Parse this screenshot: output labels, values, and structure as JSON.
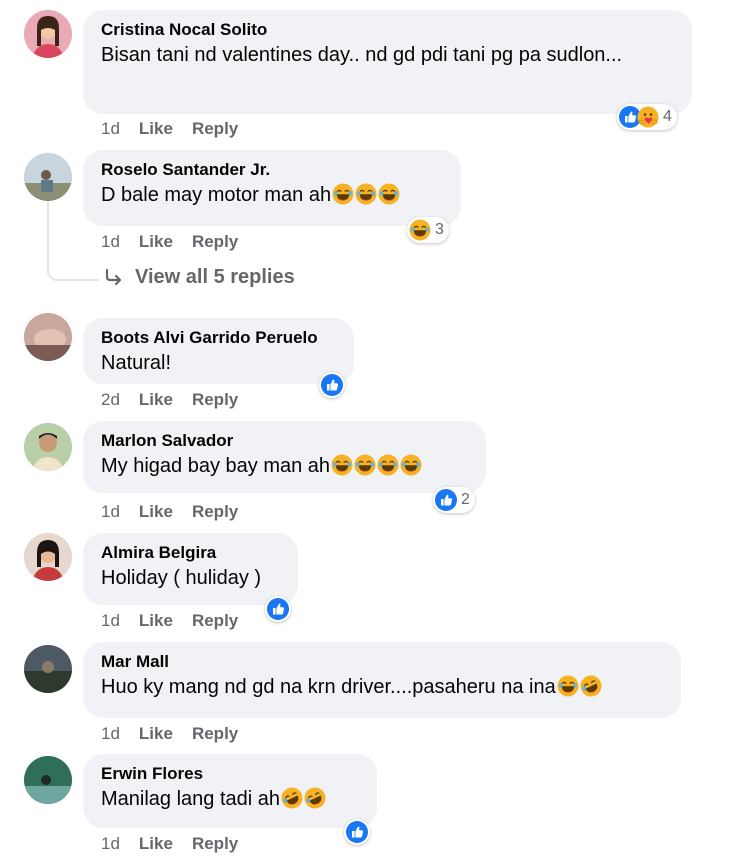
{
  "comments": [
    {
      "author": "Cristina Nocal Solito",
      "text": "Bisan tani nd valentines day.. nd gd pdi tani pg pa sudlon...",
      "time": "1d",
      "like": "Like",
      "reply": "Reply",
      "reaction_count": "4"
    },
    {
      "author": "Roselo Santander Jr.",
      "text": "D bale may motor man ah",
      "time": "1d",
      "like": "Like",
      "reply": "Reply",
      "reaction_count": "3"
    },
    {
      "author": "Boots Alvi Garrido Peruelo",
      "text": "Natural!",
      "time": "2d",
      "like": "Like",
      "reply": "Reply",
      "reaction_count": ""
    },
    {
      "author": "Marlon Salvador",
      "text": "My higad bay bay man ah",
      "time": "1d",
      "like": "Like",
      "reply": "Reply",
      "reaction_count": "2"
    },
    {
      "author": "Almira Belgira",
      "text": "Holiday ( huliday )",
      "time": "1d",
      "like": "Like",
      "reply": "Reply",
      "reaction_count": ""
    },
    {
      "author": "Mar Mall",
      "text": "Huo ky mang nd gd na krn driver....pasaheru na ina",
      "time": "1d",
      "like": "Like",
      "reply": "Reply",
      "reaction_count": ""
    },
    {
      "author": "Erwin Flores",
      "text": "Manilag lang tadi ah",
      "time": "1d",
      "like": "Like",
      "reply": "Reply",
      "reaction_count": ""
    }
  ],
  "view_replies": "View all 5 replies",
  "icons": {
    "like": "like-reaction-icon",
    "laugh": "laughing-emoji-icon",
    "rofl": "rolling-laughing-emoji-icon",
    "care": "care-reaction-icon",
    "reply_arrow": "reply-arrow-icon"
  },
  "colors": {
    "bubble": "#f0f2f5",
    "meta_text": "#65676b",
    "like_blue": "#1877f2",
    "emoji_yellow": "#f7b125"
  }
}
